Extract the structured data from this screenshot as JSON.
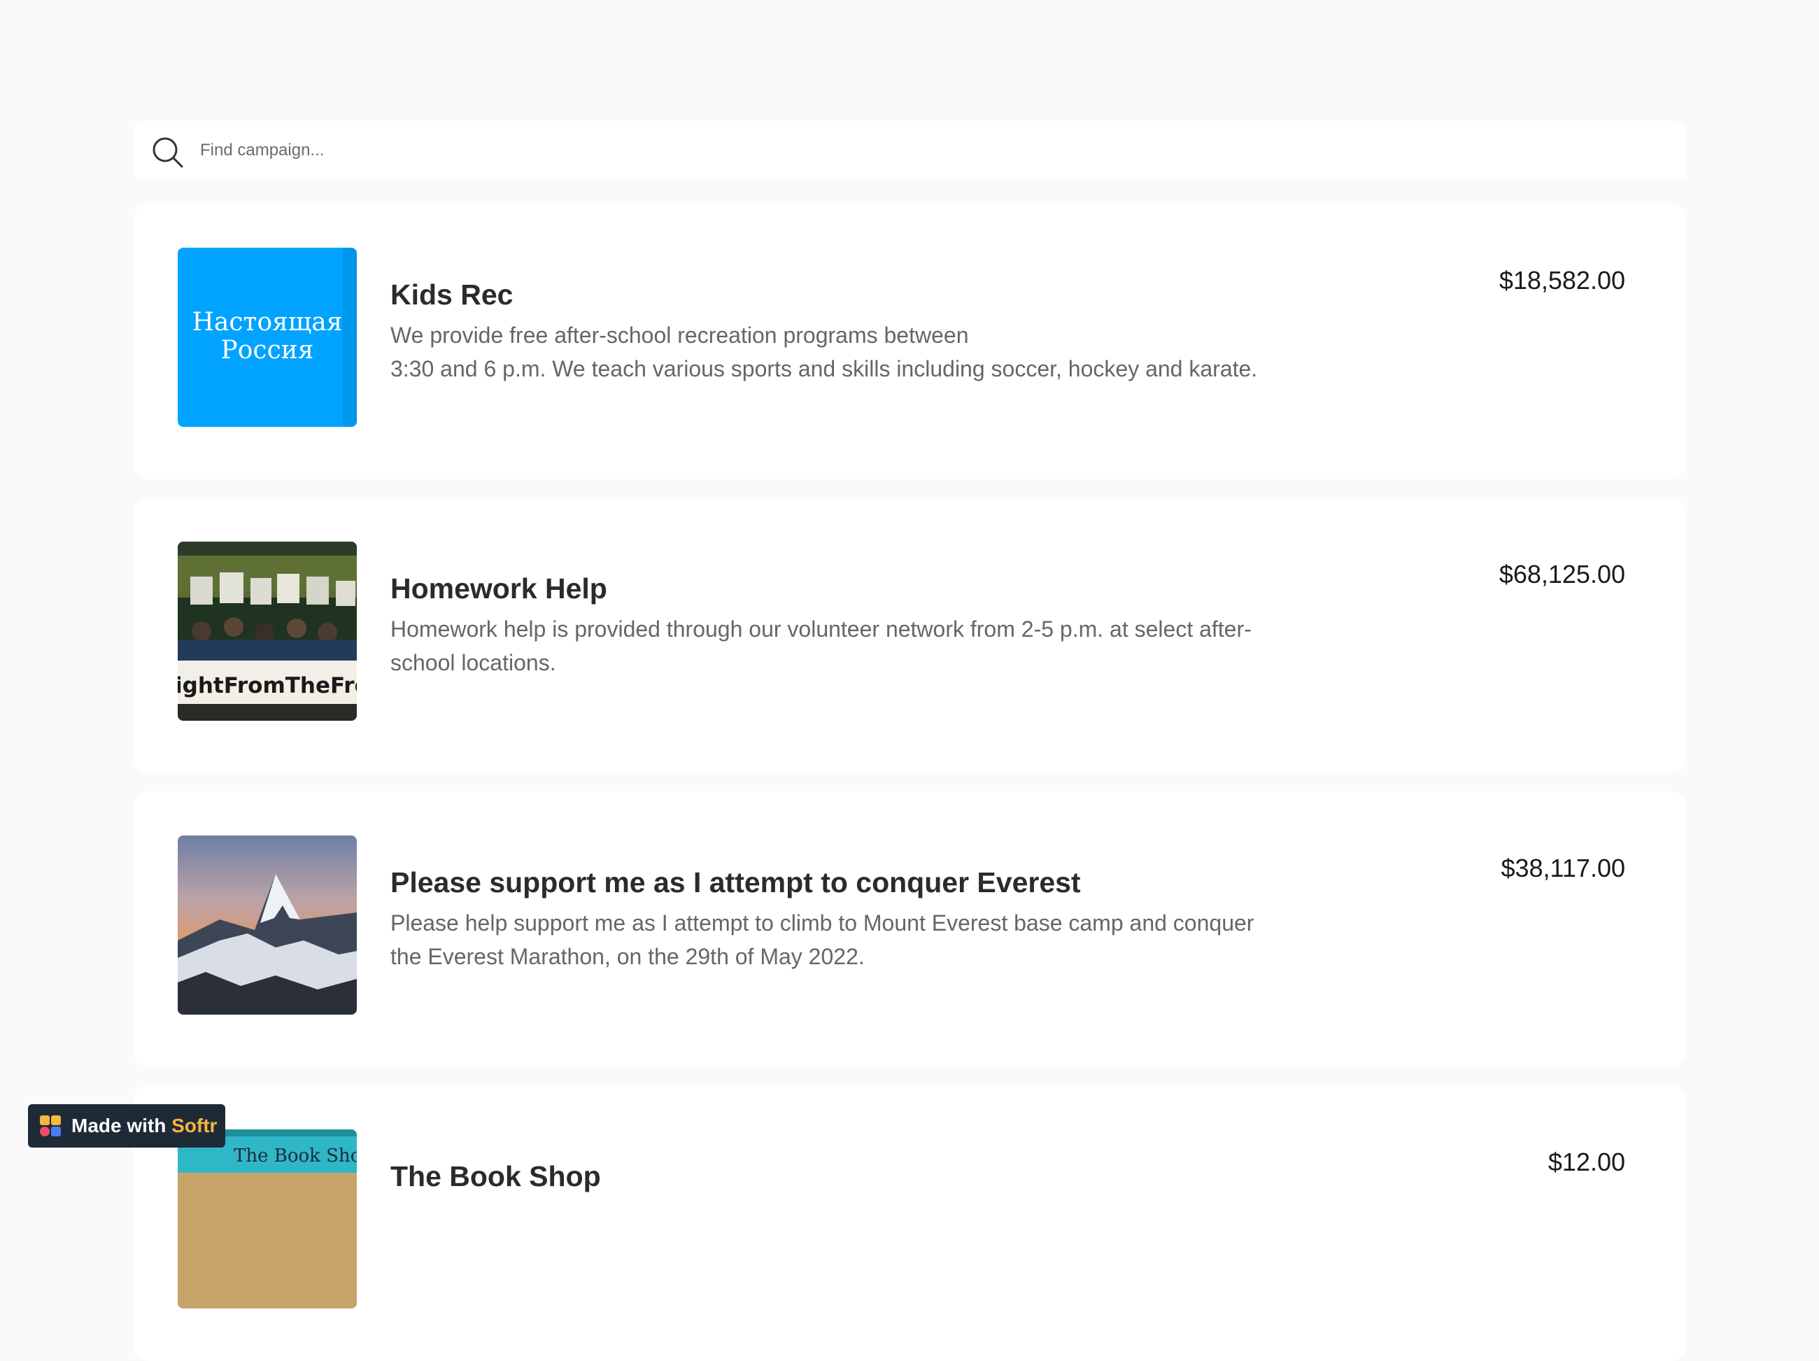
{
  "search": {
    "placeholder": "Find campaign..."
  },
  "campaigns": [
    {
      "title": "Kids Rec",
      "description_lines": [
        "We provide free after-school recreation programs between",
        "3:30 and 6 p.m. We teach various sports and skills including soccer, hockey and karate."
      ],
      "amount": "$18,582.00",
      "image_text_lines": [
        "Настоящая",
        "Россия"
      ],
      "image_bg": "#00a3ff"
    },
    {
      "title": "Homework Help",
      "description_lines": [
        "Homework help is provided through our volunteer network from 2-5 p.m. at select after-",
        "school locations."
      ],
      "amount": "$68,125.00",
      "image_text_lines": [
        "ightFromTheFron"
      ]
    },
    {
      "title": "Please support me as I attempt to conquer Everest",
      "description_lines": [
        "Please help support me as I attempt to climb to Mount Everest base camp and conquer",
        "the Everest Marathon, on the 29th of May 2022."
      ],
      "amount": "$38,117.00"
    },
    {
      "title": "The Book Shop",
      "description_lines": [],
      "amount": "$12.00",
      "image_text_lines": [
        "The Book Shop"
      ]
    }
  ],
  "badge": {
    "prefix": "Made with",
    "brand": "Softr",
    "brand_color": "#f6b73c",
    "bg_color": "#1f2a37"
  }
}
